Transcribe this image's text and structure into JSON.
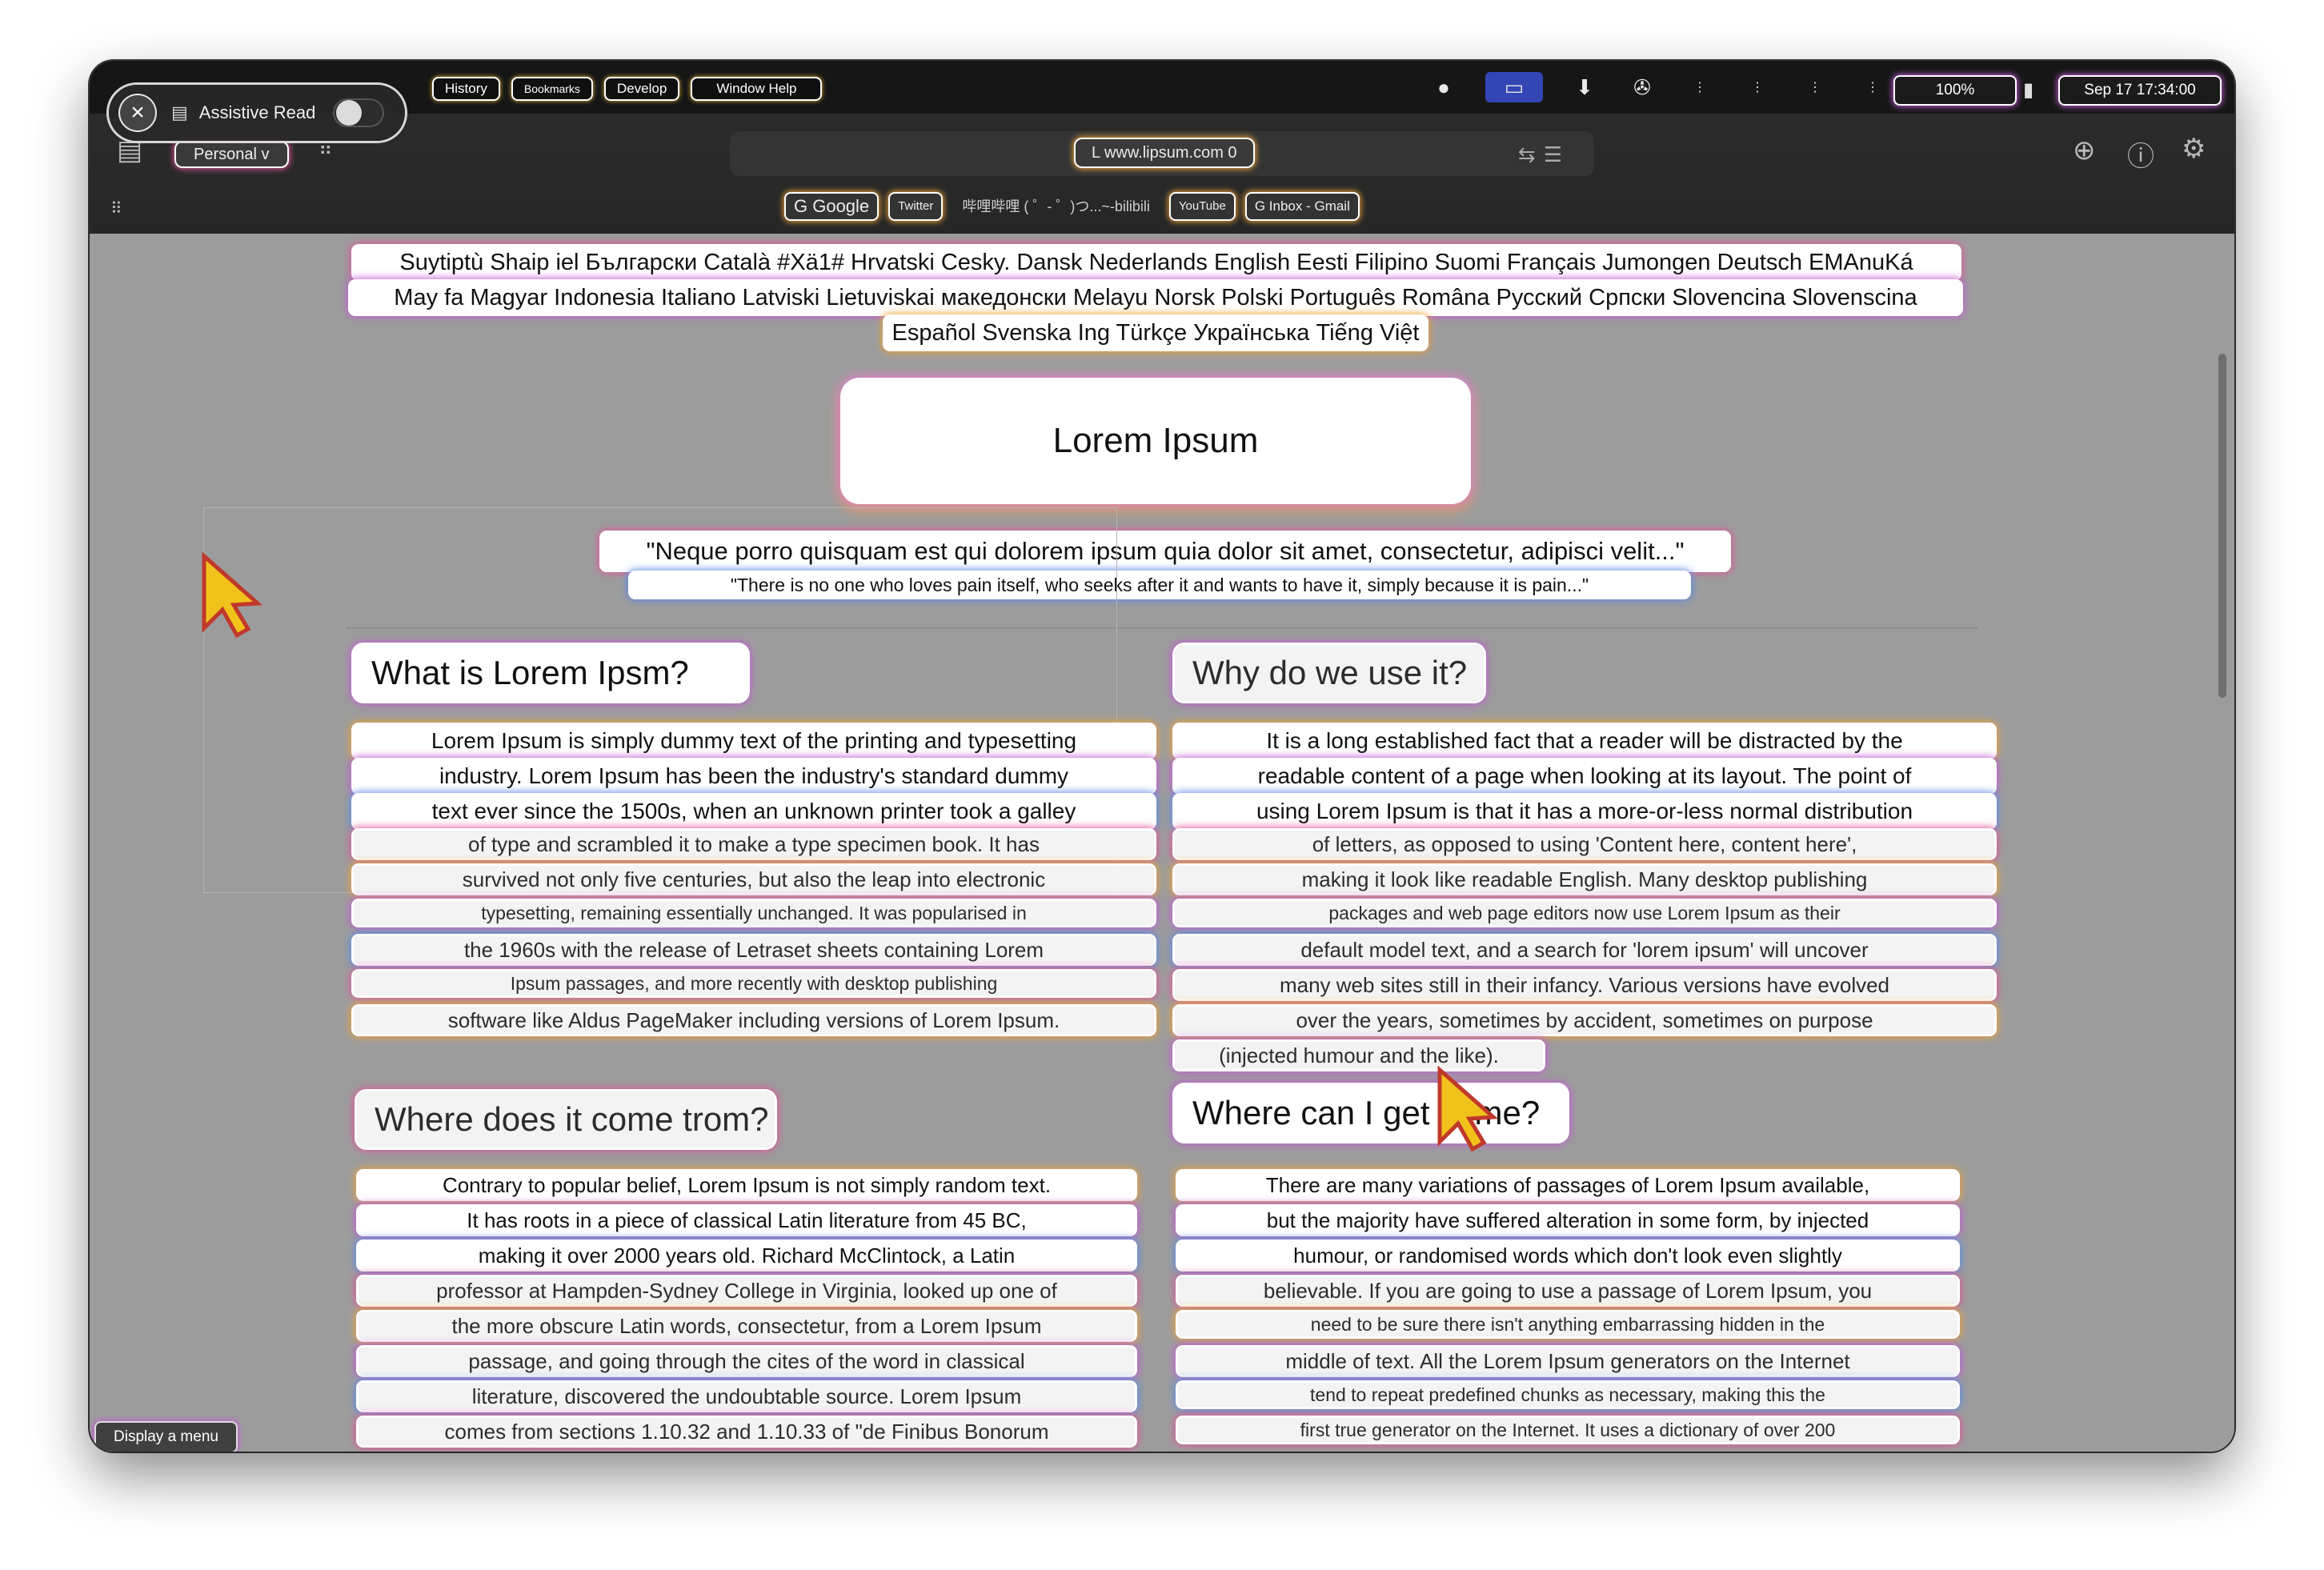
{
  "menubar": {
    "menus": [
      "History",
      "Bookmarks",
      "Develop",
      "Window Help"
    ],
    "battery": "100%",
    "clock": "Sep 17 17:34:00"
  },
  "assistive": {
    "label": "Assistive Read"
  },
  "toolbar": {
    "profile": "Personal v",
    "url": "L www.lipsum.com 0"
  },
  "favorites": [
    {
      "label": "G Google"
    },
    {
      "label": "Twitter"
    },
    {
      "label": "哔哩哔哩 ( ゜- ゜)つ...~-bilibili"
    },
    {
      "label": "YouTube"
    },
    {
      "label": "G Inbox - Gmail"
    }
  ],
  "languages": [
    "Suytiptù Shaip iel Български Català #Xä1# Hrvatski Cesky. Dansk Nederlands English Eesti Filipino Suomi Français Jumongen Deutsch EMAnuKá",
    "May fa Magyar Indonesia Italiano Latviski Lietuviskai македонски Melayu Norsk Polski Português Româna Русский Српски Slovencina Slovenscina",
    "Español Svenska Ing Türkçe Українська Tiếng Việt"
  ],
  "page": {
    "title": "Lorem Ipsum",
    "quote": "\"Neque porro quisquam est qui dolorem ipsum quia dolor sit amet, consectetur, adipisci velit...\"",
    "quote_translation": "\"There is no one who loves pain itself, who seeks after it and wants to have it, simply because it is pain...\""
  },
  "sections": {
    "what": {
      "heading": "What is Lorem Ipsm?",
      "lines": [
        "Lorem Ipsum is simply dummy text of the printing and typesetting",
        "industry. Lorem Ipsum has been the industry's standard dummy",
        "text ever since the 1500s, when an unknown printer took a galley",
        "of type and scrambled it to make a type specimen book. It has",
        "survived not only five centuries, but also the leap into electronic",
        "typesetting, remaining essentially unchanged. It was popularised in",
        "the 1960s with the release of Letraset sheets containing Lorem",
        "Ipsum passages, and more recently with desktop publishing",
        "software like Aldus PageMaker including versions of Lorem Ipsum."
      ]
    },
    "why": {
      "heading": "Why do we use it?",
      "lines": [
        "It is a long established fact that a reader will be distracted by the",
        "readable content of a page when looking at its layout. The point of",
        "using Lorem Ipsum is that it has a more-or-less normal distribution",
        "of letters, as opposed to using 'Content here, content here',",
        "making it look like readable English. Many desktop publishing",
        "packages and web page editors now use Lorem Ipsum as their",
        "default model text, and a search for 'lorem ipsum' will uncover",
        "many web sites still in their infancy. Various versions have evolved",
        "over the years, sometimes by accident, sometimes on purpose",
        "(injected humour and the like)."
      ]
    },
    "where_from": {
      "heading": "Where does it come trom?",
      "lines": [
        "Contrary to popular belief, Lorem Ipsum is not simply random text.",
        "It has roots in a piece of classical Latin literature from 45 BC,",
        "making it over 2000 years old. Richard McClintock, a Latin",
        "professor at Hampden-Sydney College in Virginia, looked up one of",
        "the more obscure Latin words, consectetur, from a Lorem Ipsum",
        "passage, and going through the cites of the word in classical",
        "literature, discovered the undoubtable source. Lorem Ipsum",
        "comes from sections 1.10.32 and 1.10.33 of \"de Finibus Bonorum"
      ]
    },
    "where_get": {
      "heading": "Where can I get some?",
      "lines": [
        "There are many variations of passages of Lorem Ipsum available,",
        "but the majority have suffered alteration in some form, by injected",
        "humour, or randomised words which don't look even slightly",
        "believable. If you are going to use a passage of Lorem Ipsum, you",
        "need to be sure there isn't anything embarrassing hidden in the",
        "middle of text. All the Lorem Ipsum generators on the Internet",
        "tend to repeat predefined chunks as necessary, making this the",
        "first true generator on the Internet. It uses a dictionary of over 200"
      ]
    }
  },
  "footer": {
    "display_menu": "Display a menu"
  },
  "colors": {
    "glow_orange": "#f0a33a",
    "glow_purple": "#c45bd8",
    "glow_blue": "#5a8be8",
    "glow_pink": "#e0569e"
  }
}
